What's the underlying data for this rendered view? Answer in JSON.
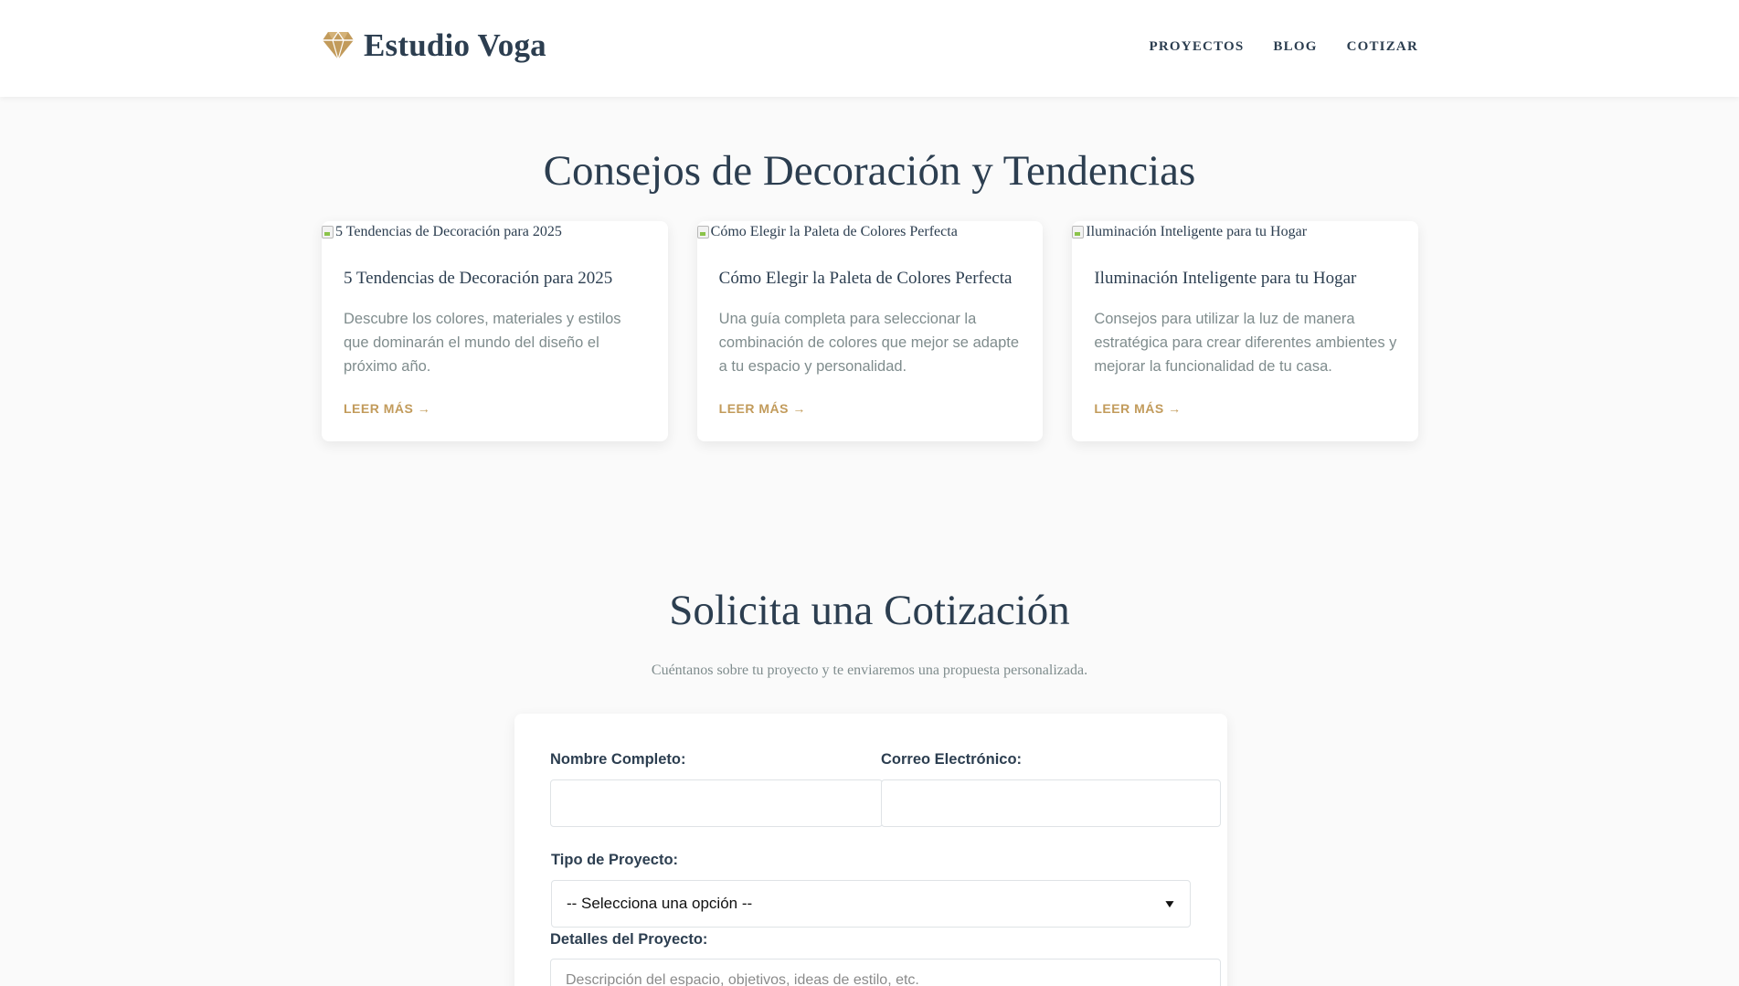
{
  "header": {
    "brand_name": "Estudio Voga",
    "brand_icon": "diamond-icon",
    "brand_color": "#c29b5b",
    "nav": [
      {
        "label": "PROYECTOS"
      },
      {
        "label": "BLOG"
      },
      {
        "label": "COTIZAR"
      }
    ]
  },
  "blog": {
    "title": "Consejos de Decoración y Tendencias",
    "cards": [
      {
        "image_alt": "5 Tendencias de Decoración para 2025",
        "title": "5 Tendencias de Decoración para 2025",
        "text": "Descubre los colores, materiales y estilos que dominarán el mundo del diseño el próximo año.",
        "link": "LEER MÁS →"
      },
      {
        "image_alt": "Cómo Elegir la Paleta de Colores Perfecta",
        "title": "Cómo Elegir la Paleta de Colores Perfecta",
        "text": "Una guía completa para seleccionar la combinación de colores que mejor se adapte a tu espacio y personalidad.",
        "link": "LEER MÁS →"
      },
      {
        "image_alt": "Iluminación Inteligente para tu Hogar",
        "title": "Iluminación Inteligente para tu Hogar",
        "text": "Consejos para utilizar la luz de manera estratégica para crear diferentes ambientes y mejorar la funcionalidad de tu casa.",
        "link": "LEER MÁS →"
      }
    ]
  },
  "quote": {
    "title": "Solicita una Cotización",
    "subtitle": "Cuéntanos sobre tu proyecto y te enviaremos una propuesta personalizada.",
    "form": {
      "name_label": "Nombre Completo:",
      "name_value": "",
      "email_label": "Correo Electrónico:",
      "email_value": "",
      "type_label": "Tipo de Proyecto:",
      "type_selected": "-- Selecciona una opción --",
      "details_label": "Detalles del Proyecto:",
      "details_placeholder": "Descripción del espacio, objetivos, ideas de estilo, etc."
    }
  }
}
